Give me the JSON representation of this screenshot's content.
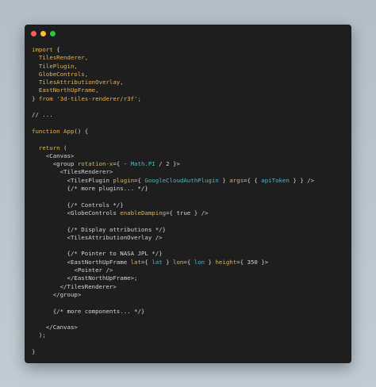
{
  "window": {
    "buttons": {
      "close": "close",
      "minimize": "minimize",
      "maximize": "maximize"
    }
  },
  "code": [
    [
      {
        "t": "import",
        "c": "kw"
      },
      {
        "t": " {",
        "c": "pun"
      }
    ],
    [
      {
        "t": "  TilesRenderer,",
        "c": "kw"
      }
    ],
    [
      {
        "t": "  TilePlugin,",
        "c": "kw"
      }
    ],
    [
      {
        "t": "  GlobeControls,",
        "c": "kw"
      }
    ],
    [
      {
        "t": "  TilesAttributionOverlay,",
        "c": "kw"
      }
    ],
    [
      {
        "t": "  EastNorthUpFrame,",
        "c": "kw"
      }
    ],
    [
      {
        "t": "} ",
        "c": "pun"
      },
      {
        "t": "from",
        "c": "kw"
      },
      {
        "t": " '3d-tiles-renderer/r3f';",
        "c": "str"
      }
    ],
    [],
    [
      {
        "t": "// ...",
        "c": "cmt"
      }
    ],
    [],
    [
      {
        "t": "function",
        "c": "kw"
      },
      {
        "t": " App",
        "c": "fn"
      },
      {
        "t": "() {",
        "c": "pun"
      }
    ],
    [],
    [
      {
        "t": "  return",
        "c": "kw"
      },
      {
        "t": " (",
        "c": "pun"
      }
    ],
    [
      {
        "t": "    <Canvas>",
        "c": "tag"
      }
    ],
    [
      {
        "t": "      <group ",
        "c": "tag"
      },
      {
        "t": "rotation-x",
        "c": "attr"
      },
      {
        "t": "={ - ",
        "c": "pun"
      },
      {
        "t": "Math.PI",
        "c": "val"
      },
      {
        "t": " / 2 }>",
        "c": "pun"
      }
    ],
    [
      {
        "t": "        <TilesRenderer>",
        "c": "tag"
      }
    ],
    [
      {
        "t": "          <TilesPlugin ",
        "c": "tag"
      },
      {
        "t": "plugin",
        "c": "attr"
      },
      {
        "t": "={ ",
        "c": "pun"
      },
      {
        "t": "GoogleCloudAuthPlugin",
        "c": "val"
      },
      {
        "t": " } ",
        "c": "pun"
      },
      {
        "t": "args",
        "c": "attr"
      },
      {
        "t": "={ { ",
        "c": "pun"
      },
      {
        "t": "apiToken",
        "c": "val"
      },
      {
        "t": " } } />",
        "c": "pun"
      }
    ],
    [
      {
        "t": "          {/* more plugins... */}",
        "c": "cmt"
      }
    ],
    [],
    [
      {
        "t": "          {/* Controls */}",
        "c": "cmt"
      }
    ],
    [
      {
        "t": "          <GlobeControls ",
        "c": "tag"
      },
      {
        "t": "enableDamping",
        "c": "attr"
      },
      {
        "t": "={ true } />",
        "c": "pun"
      }
    ],
    [],
    [
      {
        "t": "          {/* Display attributions */}",
        "c": "cmt"
      }
    ],
    [
      {
        "t": "          <TilesAttributionOverlay />",
        "c": "tag"
      }
    ],
    [],
    [
      {
        "t": "          {/* Pointer to NASA JPL */}",
        "c": "cmt"
      }
    ],
    [
      {
        "t": "          <EastNorthUpFrame ",
        "c": "tag"
      },
      {
        "t": "lat",
        "c": "attr"
      },
      {
        "t": "={ ",
        "c": "pun"
      },
      {
        "t": "lat",
        "c": "val"
      },
      {
        "t": " } ",
        "c": "pun"
      },
      {
        "t": "lon",
        "c": "attr"
      },
      {
        "t": "={ ",
        "c": "pun"
      },
      {
        "t": "lon",
        "c": "val"
      },
      {
        "t": " } ",
        "c": "pun"
      },
      {
        "t": "height",
        "c": "attr"
      },
      {
        "t": "={ 350 }>",
        "c": "pun"
      }
    ],
    [
      {
        "t": "            <Pointer />",
        "c": "tag"
      }
    ],
    [
      {
        "t": "          </EastNorthUpFrame>;",
        "c": "tag"
      }
    ],
    [
      {
        "t": "        </TilesRenderer>",
        "c": "tag"
      }
    ],
    [
      {
        "t": "      </group>",
        "c": "tag"
      }
    ],
    [],
    [
      {
        "t": "      {/* more components... */}",
        "c": "cmt"
      }
    ],
    [],
    [
      {
        "t": "    </Canvas>",
        "c": "tag"
      }
    ],
    [
      {
        "t": "  );",
        "c": "pun"
      }
    ],
    [],
    [
      {
        "t": "}",
        "c": "pun"
      }
    ]
  ]
}
